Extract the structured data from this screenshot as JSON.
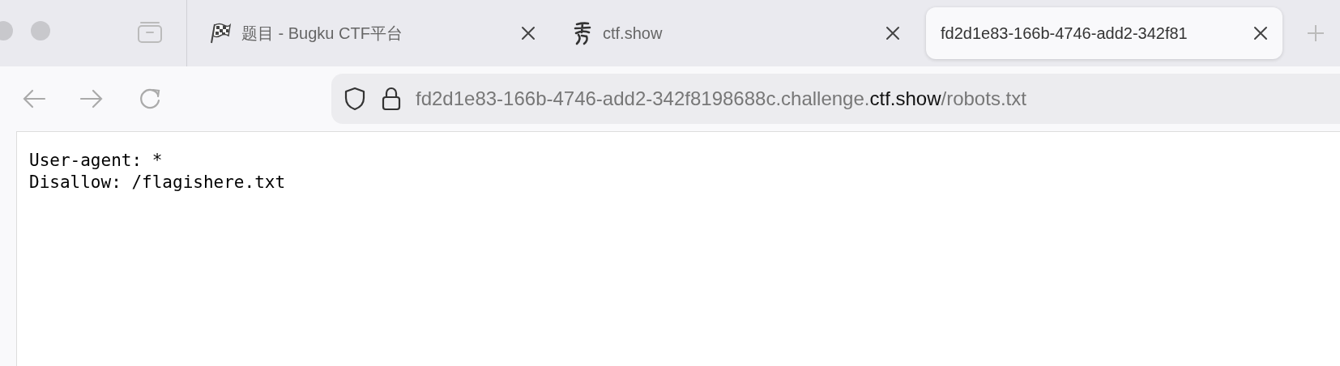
{
  "tabs": [
    {
      "title": "题目 - Bugku CTF平台",
      "selected": false,
      "kind": "flag"
    },
    {
      "title": "ctf.show",
      "selected": false,
      "kind": "glyph"
    },
    {
      "title": "fd2d1e83-166b-4746-add2-342f81",
      "selected": true,
      "kind": "none"
    }
  ],
  "address_bar": {
    "host": "fd2d1e83-166b-4746-add2-342f8198688c.challenge.",
    "domain": "ctf.show",
    "path": "/robots.txt"
  },
  "page": {
    "lines": [
      "User-agent: *",
      "Disallow: /flagishere.txt"
    ]
  }
}
